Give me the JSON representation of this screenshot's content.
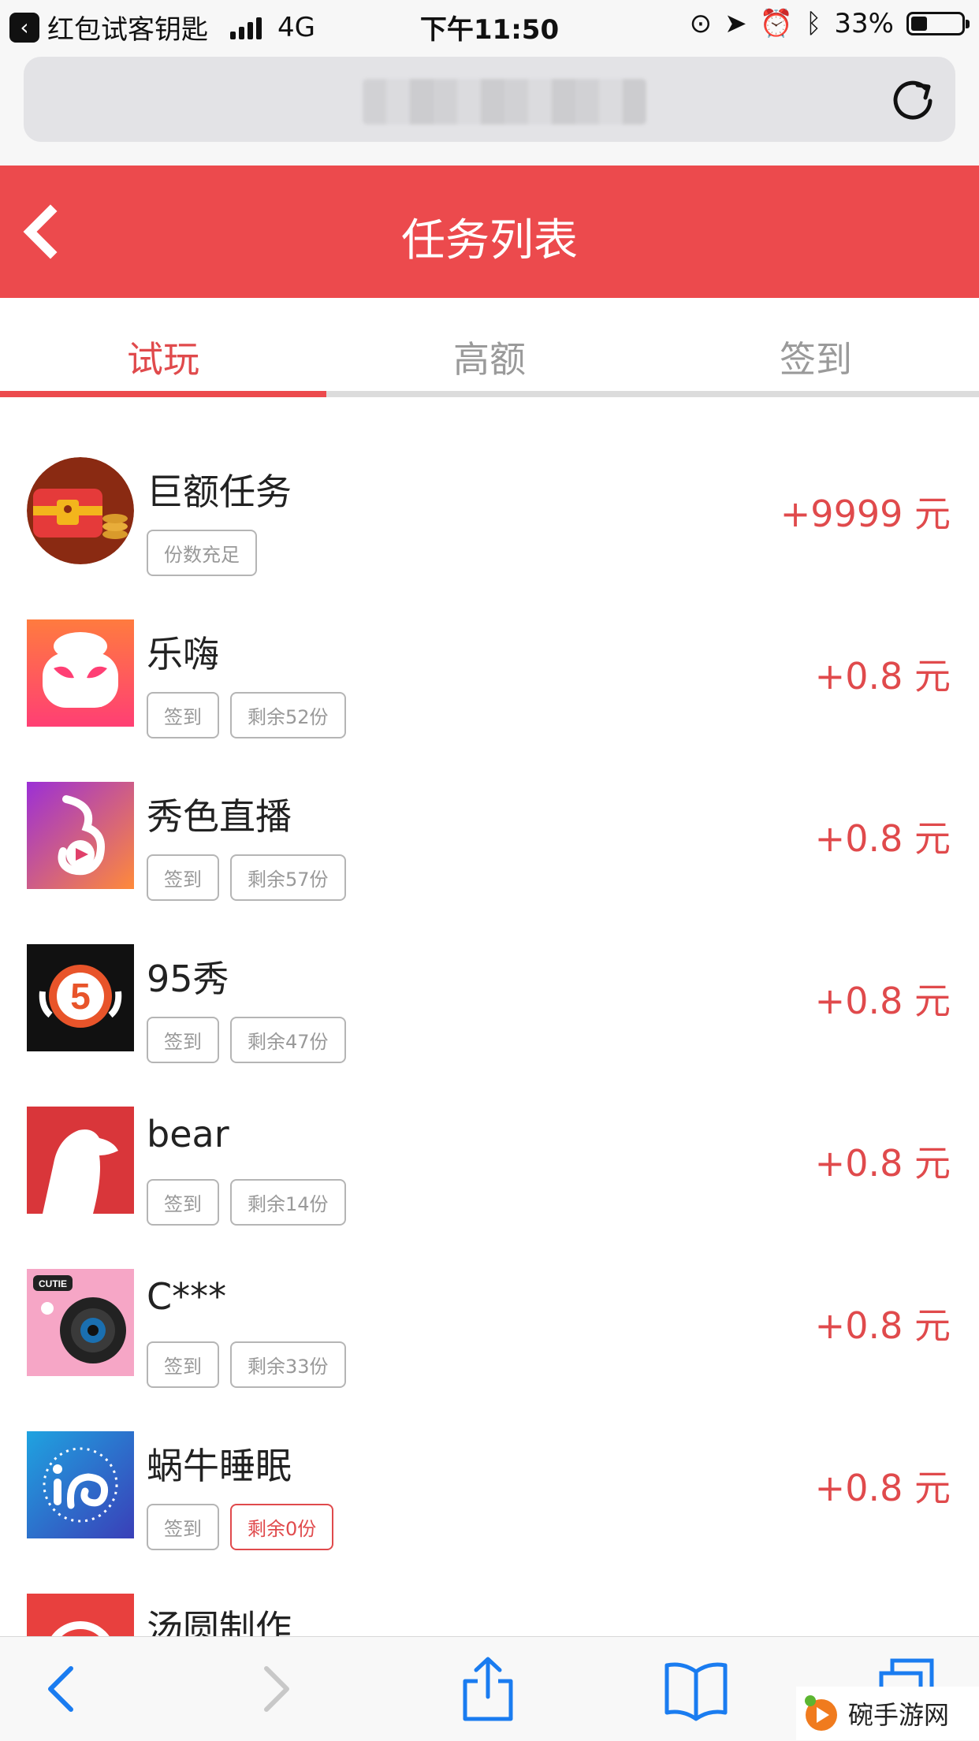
{
  "status_bar": {
    "back_app": "红包试客钥匙",
    "network": "4G",
    "time": "下午11:50",
    "battery": "33%",
    "battery_level": 0.33
  },
  "header": {
    "title": "任务列表"
  },
  "tabs": [
    {
      "label": "试玩",
      "active": true
    },
    {
      "label": "高额",
      "active": false
    },
    {
      "label": "签到",
      "active": false
    }
  ],
  "tasks": [
    {
      "name": "巨额任务",
      "tags": [
        "份数充足"
      ],
      "reward": "+9999 元"
    },
    {
      "name": "乐嗨",
      "tags": [
        "签到",
        "剩余52份"
      ],
      "reward": "+0.8 元"
    },
    {
      "name": "秀色直播",
      "tags": [
        "签到",
        "剩余57份"
      ],
      "reward": "+0.8 元"
    },
    {
      "name": "95秀",
      "tags": [
        "签到",
        "剩余47份"
      ],
      "reward": "+0.8 元"
    },
    {
      "name": "bear",
      "tags": [
        "签到",
        "剩余14份"
      ],
      "reward": "+0.8 元"
    },
    {
      "name": "C***",
      "tags": [
        "签到",
        "剩余33份"
      ],
      "reward": "+0.8 元"
    },
    {
      "name": "蜗牛睡眠",
      "tags": [
        "签到",
        "剩余0份"
      ],
      "reward": "+0.8 元"
    },
    {
      "name": "汤圆制作",
      "tags": [],
      "reward": ""
    }
  ],
  "watermark": "碗手游网",
  "colors": {
    "accent": "#ec4a4d",
    "reward": "#e04a4c"
  }
}
